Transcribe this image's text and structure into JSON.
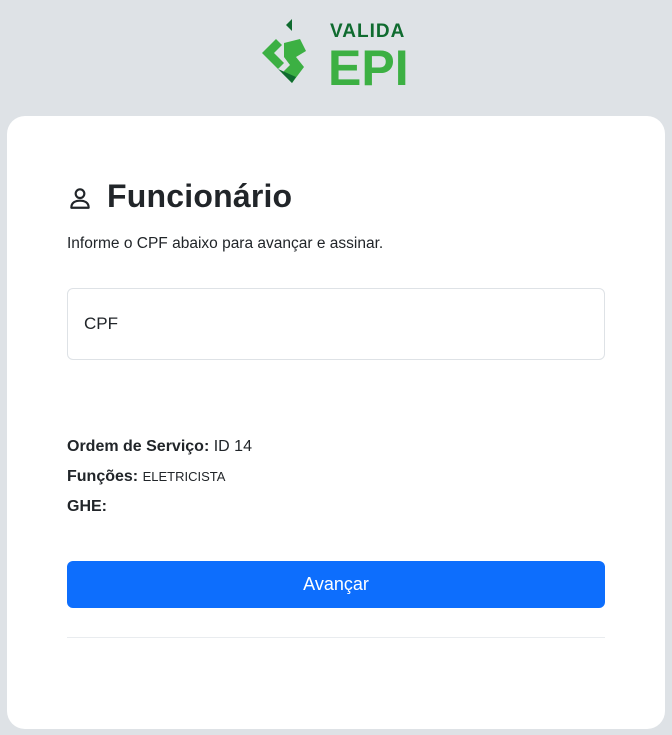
{
  "logo": {
    "text_top": "VALIDA",
    "text_bottom": "EPI",
    "color_dark": "#0f6b2f",
    "color_light": "#3cb043"
  },
  "form": {
    "title": "Funcionário",
    "subtitle": "Informe o CPF abaixo para avançar e assinar.",
    "cpf_placeholder": "CPF",
    "cpf_value": ""
  },
  "details": {
    "ordem_label": "Ordem de Serviço:",
    "ordem_value": "ID 14",
    "funcoes_label": "Funções:",
    "funcoes_value": "ELETRICISTA",
    "ghe_label": "GHE:",
    "ghe_value": ""
  },
  "actions": {
    "submit_label": "Avançar"
  },
  "colors": {
    "background": "#dee2e6",
    "card": "#ffffff",
    "primary_button": "#0d6efd"
  }
}
